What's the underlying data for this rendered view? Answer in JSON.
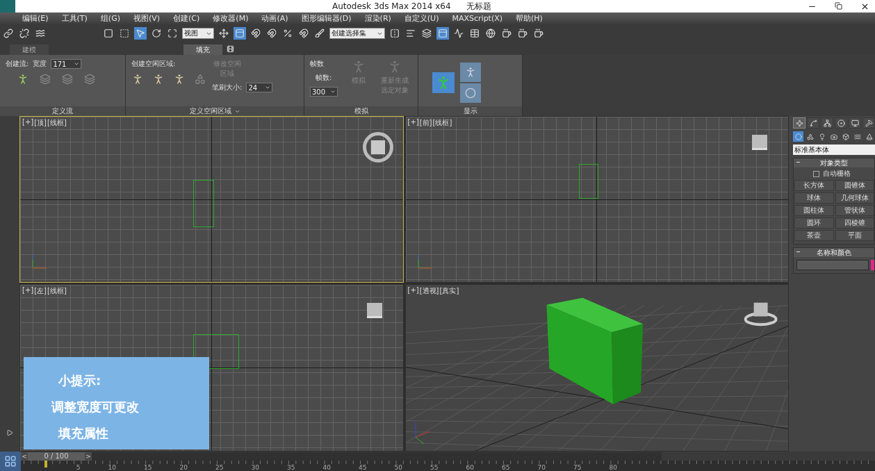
{
  "window": {
    "title": "Autodesk 3ds Max  2014 x64",
    "document": "无标题"
  },
  "menu": [
    "编辑(E)",
    "工具(T)",
    "组(G)",
    "视图(V)",
    "创建(C)",
    "修改器(M)",
    "动画(A)",
    "图形编辑器(D)",
    "渲染(R)",
    "自定义(U)",
    "MAXScript(X)",
    "帮助(H)"
  ],
  "toolbar": {
    "coordinate_dropdown": "视图",
    "selection_set_dropdown": "创建选择集"
  },
  "ribbon_tabs": [
    {
      "label": "建模",
      "selected": false
    },
    {
      "label": "填充",
      "selected": true
    }
  ],
  "ribbon": {
    "flow": {
      "label": "创建流:",
      "width_label": "宽度",
      "width_value": "171",
      "footer": "定义流"
    },
    "idle": {
      "label": "创建空闲区域:",
      "modify": {
        "label": "修改空闲区域",
        "disabled": true
      },
      "brush_label": "笔刷大小:",
      "brush_value": "24",
      "footer": "定义空闲区域"
    },
    "simulate": {
      "frames_title": "帧数",
      "frames_label": "帧数:",
      "frames_value": "300",
      "buttons": [
        {
          "label": "模拟",
          "disabled": true
        },
        {
          "label": "重新生成选定对象",
          "disabled": true
        }
      ],
      "footer": "模拟"
    },
    "display": {
      "footer": "显示"
    }
  },
  "viewports": [
    {
      "labels": [
        "[+]",
        "[顶]",
        "[线框]"
      ],
      "kind": "ortho",
      "selected": true
    },
    {
      "labels": [
        "[+]",
        "[前]",
        "[线框]"
      ],
      "kind": "ortho",
      "selected": false
    },
    {
      "labels": [
        "[+]",
        "[左]",
        "[线框]"
      ],
      "kind": "ortho",
      "selected": false
    },
    {
      "labels": [
        "[+]",
        "[透视]",
        "[真实]"
      ],
      "kind": "perspective",
      "selected": false
    }
  ],
  "tip": {
    "title": "小提示:",
    "lines": [
      "调整宽度可更改",
      "填充属性"
    ]
  },
  "command_panel": {
    "tabs": [
      {
        "selected": true
      },
      {
        "selected": false
      },
      {
        "selected": false
      },
      {
        "selected": false
      },
      {
        "selected": false
      },
      {
        "selected": false
      }
    ],
    "subtabs": [
      {
        "selected": true
      },
      {
        "selected": false
      },
      {
        "selected": false
      },
      {
        "selected": false
      },
      {
        "selected": false
      },
      {
        "selected": false
      },
      {
        "selected": false
      }
    ],
    "category": "标准基本体",
    "object_type": {
      "title": "对象类型",
      "autogrid": {
        "label": "自动栅格",
        "checked": false
      },
      "buttons": [
        "长方体",
        "圆锥体",
        "球体",
        "几何球体",
        "圆柱体",
        "管状体",
        "圆环",
        "四棱锥",
        "茶壶",
        "平面"
      ]
    },
    "name_color": {
      "title": "名称和颜色",
      "color": "#e0288c"
    }
  },
  "timeline": {
    "prev": "<",
    "position": "0 / 100",
    "next": ">",
    "ticks": [
      "5",
      "10",
      "15",
      "20",
      "25",
      "30",
      "35",
      "40",
      "45",
      "50",
      "55",
      "60",
      "65",
      "70",
      "75",
      "80"
    ]
  }
}
